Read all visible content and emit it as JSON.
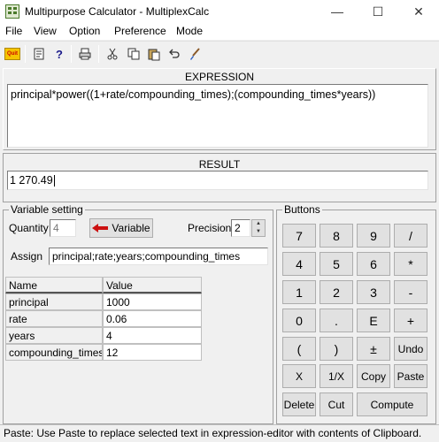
{
  "window": {
    "title": "Multipurpose Calculator - MultiplexCalc",
    "minimize": "—",
    "maximize": "☐",
    "close": "✕"
  },
  "menu": [
    "File",
    "View",
    "Option",
    "Preference",
    "Mode"
  ],
  "toolbar": {
    "quit_label": "Quit",
    "icons": [
      "quit-icon",
      "document-icon",
      "help-icon",
      "print-icon",
      "cut-icon",
      "copy-icon",
      "paste-icon",
      "undo-icon",
      "brush-icon"
    ]
  },
  "expression": {
    "label": "EXPRESSION",
    "value": "principal*power((1+rate/compounding_times);(compounding_times*years))"
  },
  "result": {
    "label": "RESULT",
    "value": "1 270.49"
  },
  "variable_setting": {
    "title": "Variable setting",
    "quantity_label": "Quantity",
    "quantity_value": "4",
    "variable_button": "Variable",
    "precision_label": "Precision",
    "precision_value": "2",
    "assign_label": "Assign",
    "assign_value": "principal;rate;years;compounding_times",
    "table": {
      "headers": [
        "Name",
        "Value"
      ],
      "rows": [
        [
          "principal",
          "1000"
        ],
        [
          "rate",
          "0.06"
        ],
        [
          "years",
          "4"
        ],
        [
          "compounding_times",
          "12"
        ]
      ]
    }
  },
  "buttons": {
    "title": "Buttons",
    "rows": [
      [
        "7",
        "8",
        "9",
        "/"
      ],
      [
        "4",
        "5",
        "6",
        "*"
      ],
      [
        "1",
        "2",
        "3",
        "-"
      ],
      [
        "0",
        ".",
        "E",
        "+"
      ],
      [
        "(",
        ")",
        "±",
        "Undo"
      ],
      [
        "X",
        "1/X",
        "Copy",
        "Paste"
      ]
    ],
    "delete": "Delete",
    "cut": "Cut",
    "compute": "Compute"
  },
  "status": "Paste: Use Paste to replace selected text in expression-editor with contents of Clipboard.",
  "colors": {
    "accent_arrow": "#cc1111",
    "window_bg": "#f0f0f0"
  }
}
